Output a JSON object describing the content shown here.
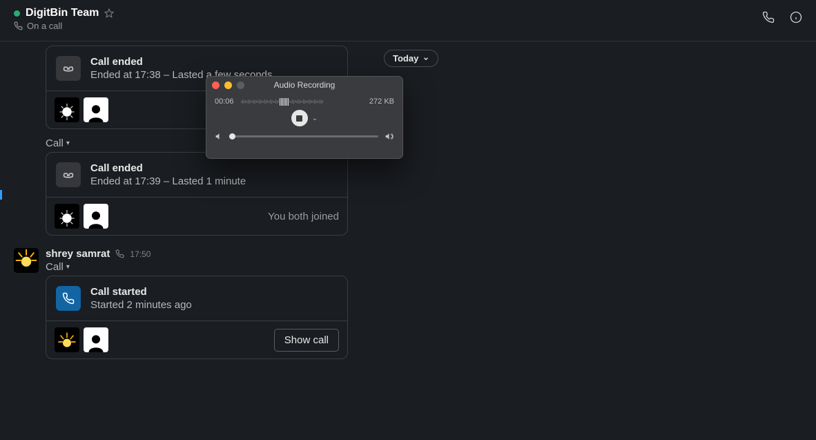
{
  "header": {
    "title": "DigitBin Team",
    "subtitle": "On a call"
  },
  "today_label": "Today",
  "calls": [
    {
      "label": null,
      "type": "ended",
      "title": "Call ended",
      "subtitle": "Ended at 17:38 – Lasted a few seconds",
      "footer_text": null,
      "button": null
    },
    {
      "label": "Call",
      "type": "ended",
      "title": "Call ended",
      "subtitle": "Ended at 17:39 – Lasted 1 minute",
      "footer_text": "You both joined",
      "button": null
    },
    {
      "label": "Call",
      "type": "started",
      "title": "Call started",
      "subtitle": "Started 2 minutes ago",
      "footer_text": null,
      "button": "Show call"
    }
  ],
  "message": {
    "author": "shrey samrat",
    "time": "17:50"
  },
  "recorder": {
    "title": "Audio Recording",
    "time": "00:06",
    "size": "272 KB"
  }
}
